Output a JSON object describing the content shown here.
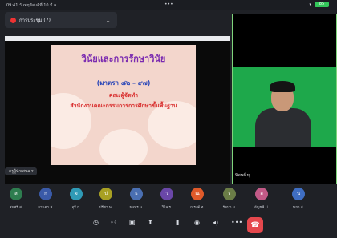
{
  "status_bar": {
    "time_left": "09:41  วันพฤหัสบดีที่ 10 มี.ค.",
    "center_dots": "•••",
    "wifi": "▾",
    "battery": "85"
  },
  "meeting": {
    "title": "การประชุม (7)"
  },
  "shared_screen": {
    "slide_title": "วินัยและการรักษาวินัย",
    "slide_subtitle": "(มาตรา ๘๒ – ๙๗)",
    "slide_line1": "คณะผู้จัดทำ",
    "slide_line2": "สำนักงานคณะกรรมการการศึกษาขั้นพื้นฐาน",
    "presenter_label": "ครูผู้นำเสนอ ▾"
  },
  "camera": {
    "name": "นิพนธ์ ทุ"
  },
  "participants": [
    {
      "initial": "ส",
      "name": "สมศรี ส.",
      "color": "#2e7d4f"
    },
    {
      "initial": "ก",
      "name": "กานดา ส.",
      "color": "#3a5aa8"
    },
    {
      "initial": "จ",
      "name": "จุรี ก.",
      "color": "#2f9ab6"
    },
    {
      "initial": "ป",
      "name": "ปรีชา พ.",
      "color": "#a8a023"
    },
    {
      "initial": "ธ",
      "name": "ธนพร น.",
      "color": "#4a6fb2"
    },
    {
      "initial": "ว",
      "name": "วิไล ร.",
      "color": "#6a47a8"
    },
    {
      "initial": "ณ",
      "name": "ณรงค์ ท.",
      "color": "#e05a2a"
    },
    {
      "initial": "ร",
      "name": "รัตนา ม.",
      "color": "#6b7d47"
    },
    {
      "initial": "อ",
      "name": "อัญชลี ป.",
      "color": "#c25a87"
    },
    {
      "initial": "น",
      "name": "นภา ส.",
      "color": "#3f6ec2"
    }
  ],
  "controls": {
    "timer": "◷",
    "people": "⚇",
    "layout": "▣",
    "share": "⬆",
    "mic": "▮",
    "video": "◉",
    "speaker": "◂)",
    "more": "•••",
    "end": "☎"
  }
}
